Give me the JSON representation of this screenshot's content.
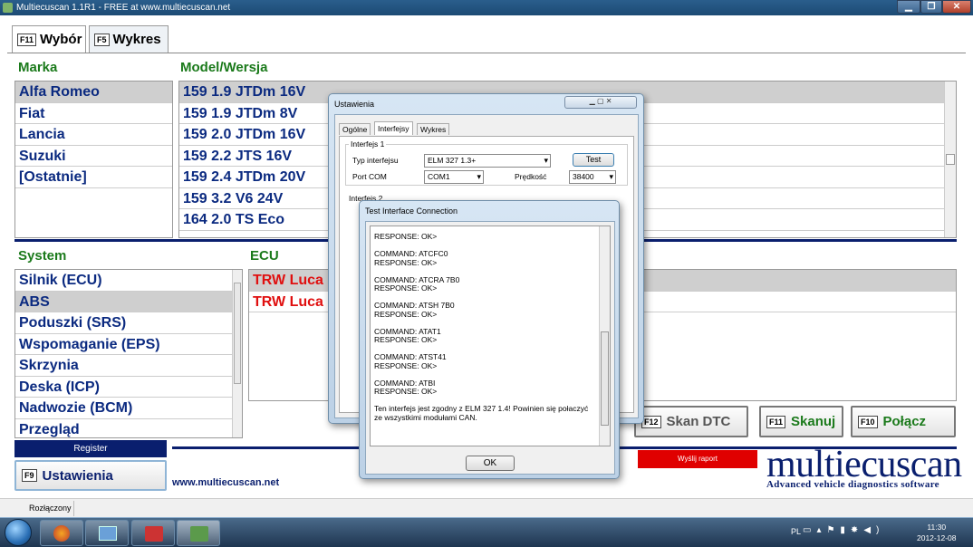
{
  "window": {
    "title": "Multiecuscan 1.1R1 - FREE at www.multiecuscan.net",
    "buttons": {
      "min": "▁",
      "max": "❐",
      "close": "✕"
    }
  },
  "tabs": [
    {
      "key": "F11",
      "label": "Wybór"
    },
    {
      "key": "F5",
      "label": "Wykres"
    }
  ],
  "headers": {
    "marka": "Marka",
    "model": "Model/Wersja",
    "system": "System",
    "ecu": "ECU"
  },
  "makes": [
    "Alfa Romeo",
    "Fiat",
    "Lancia",
    "Suzuki",
    "[Ostatnie]"
  ],
  "models": [
    "159 1.9 JTDm 16V",
    "159 1.9 JTDm 8V",
    "159 2.0 JTDm 16V",
    "159 2.2 JTS 16V",
    "159 2.4 JTDm 20V",
    "159 3.2 V6 24V",
    "164 2.0 TS Eco"
  ],
  "systems": [
    "Silnik (ECU)",
    "ABS",
    "Poduszki (SRS)",
    "Wspomaganie (EPS)",
    "Skrzynia",
    "Deska (ICP)",
    "Nadwozie (BCM)",
    "Przegląd"
  ],
  "ecus": [
    "TRW Luca",
    "TRW Luca"
  ],
  "buttons": {
    "register": "Register",
    "settings_key": "F9",
    "settings": "Ustawienia",
    "scan_dtc_key": "F12",
    "scan_dtc": "Skan DTC",
    "scan_key": "F11",
    "scan": "Skanuj",
    "connect_key": "F10",
    "connect": "Połącz",
    "send_report": "Wyślij raport"
  },
  "website": "www.multiecuscan.net",
  "brand": {
    "logo": "multiecuscan",
    "tagline": "Advanced vehicle diagnostics software"
  },
  "status": "Rozłączony",
  "settings_dialog": {
    "title": "Ustawienia",
    "tabs": [
      "Ogólne",
      "Interfejsy",
      "Wykres"
    ],
    "group1": "Interfejs 1",
    "type_label": "Typ interfejsu",
    "type_value": "ELM 327 1.3+",
    "test": "Test",
    "port_label": "Port COM",
    "port_value": "COM1",
    "speed_label": "Prędkość",
    "speed_value": "38400",
    "group2": "Interfejs 2"
  },
  "test_dialog": {
    "title": "Test Interface Connection",
    "log": [
      "RESPONSE: OK>",
      "",
      "COMMAND: ATCFC0",
      "RESPONSE: OK>",
      "",
      "COMMAND: ATCRA 7B0",
      "RESPONSE: OK>",
      "",
      "COMMAND: ATSH 7B0",
      "RESPONSE: OK>",
      "",
      "COMMAND: ATAT1",
      "RESPONSE: OK>",
      "",
      "COMMAND: ATST41",
      "RESPONSE: OK>",
      "",
      "COMMAND: ATBI",
      "RESPONSE: OK>",
      "",
      "Ten interfejs jest zgodny z ELM 327 1.4! Powinien się połaczyć",
      "ze wszystkimi modułami CAN."
    ],
    "ok": "OK"
  },
  "tray": {
    "lang": "PL",
    "time": "11:30",
    "date": "2012-12-08"
  },
  "colors": {
    "accent_green": "#1b7a1b",
    "list_blue": "#0b2a80",
    "ecu_red": "#e01010",
    "navy": "#0a1f6e",
    "report_red": "#e00000"
  }
}
